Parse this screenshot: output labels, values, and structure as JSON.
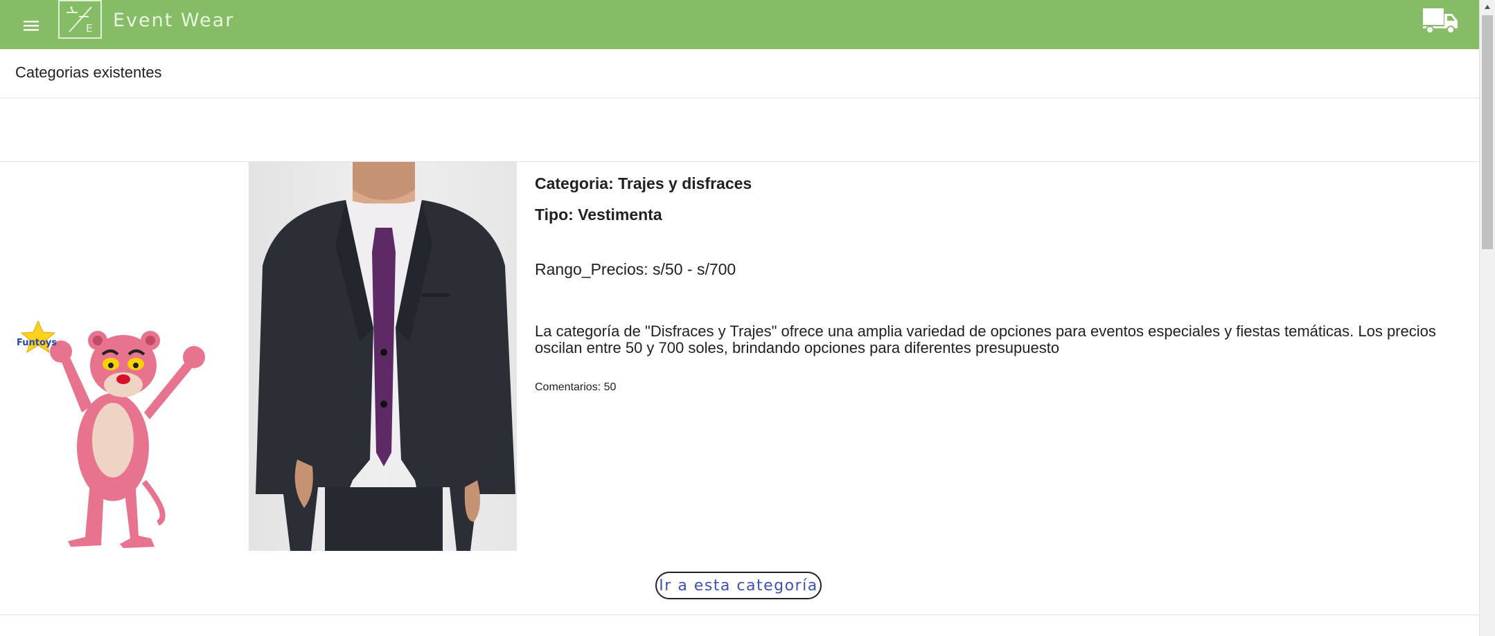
{
  "toolbar": {
    "menu_icon": "hamburger-menu-icon",
    "logo_icon": "event-wear-logo-icon",
    "logo_letter": "E",
    "brand": "Event Wear",
    "cart_icon": "delivery-truck-icon"
  },
  "header": {
    "title": "Categorias existentes"
  },
  "category": {
    "images": [
      "pink-panther-costume-image",
      "man-in-suit-image"
    ],
    "costume_badge": "Funtoys",
    "title": "Categoria: Trajes y disfraces",
    "type": "Tipo: Vestimenta",
    "price_range": "Rango_Precios: s/50 - s/700",
    "description": "La categoría de \"Disfraces y Trajes\" ofrece una amplia variedad de opciones para eventos especiales y fiestas temáticas. Los precios oscilan entre 50 y 700 soles, brindando opciones para diferentes presupuesto",
    "comments": "Comentarios: 50",
    "button_label": "Ir a esta categoría"
  },
  "colors": {
    "toolbar": "#86bc66",
    "button_text": "#3f51b5"
  }
}
